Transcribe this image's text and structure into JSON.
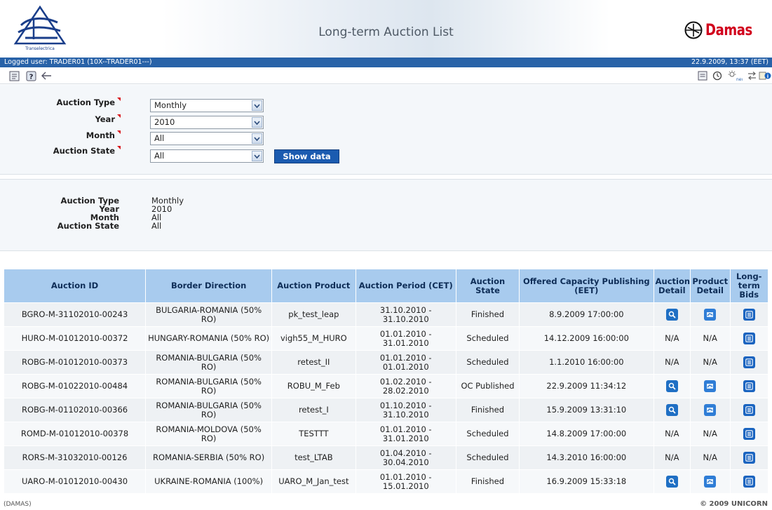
{
  "header": {
    "title": "Long-term Auction List",
    "left_logo_text": "Transelectrica",
    "right_logo_text": "Damas"
  },
  "userbar": {
    "logged_user": "Logged user: TRADER01 (10X--TRADER01---)",
    "datetime": "22.9.2009, 13:37 (EET)"
  },
  "toolbar": {
    "left_icons": [
      "document-icon",
      "help-icon",
      "back-arrow-icon"
    ],
    "right_icons": [
      "list-icon",
      "clock-icon",
      "new-sun-icon",
      "transfer-icon",
      "notes-info-icon"
    ]
  },
  "filter": {
    "auction_type_label": "Auction Type",
    "auction_type_value": "Monthly",
    "year_label": "Year",
    "year_value": "2010",
    "month_label": "Month",
    "month_value": "All",
    "state_label": "Auction State",
    "state_value": "All",
    "show_button": "Show data"
  },
  "summary": {
    "labels": [
      "Auction Type",
      "Year",
      "Month",
      "Auction State"
    ],
    "values": [
      "Monthly",
      "2010",
      "All",
      "All"
    ]
  },
  "table": {
    "headers": [
      "Auction ID",
      "Border Direction",
      "Auction Product",
      "Auction Period (CET)",
      "Auction State",
      "Offered Capacity Publishing (EET)",
      "Auction Detail",
      "Product Detail",
      "Long-term Bids"
    ],
    "rows": [
      {
        "id": "BGRO-M-31102010-00243",
        "border": "BULGARIA-ROMANIA (50% RO)",
        "product": "pk_test_leap",
        "period": "31.10.2010 - 31.10.2010",
        "state": "Finished",
        "publishing": "8.9.2009 17:00:00",
        "auction_detail": "icon",
        "product_detail": "icon"
      },
      {
        "id": "HURO-M-01012010-00372",
        "border": "HUNGARY-ROMANIA (50% RO)",
        "product": "vigh55_M_HURO",
        "period": "01.01.2010 - 31.01.2010",
        "state": "Scheduled",
        "publishing": "14.12.2009 16:00:00",
        "auction_detail": "N/A",
        "product_detail": "N/A"
      },
      {
        "id": "ROBG-M-01012010-00373",
        "border": "ROMANIA-BULGARIA (50% RO)",
        "product": "retest_II",
        "period": "01.01.2010 - 01.01.2010",
        "state": "Scheduled",
        "publishing": "1.1.2010 16:00:00",
        "auction_detail": "N/A",
        "product_detail": "N/A"
      },
      {
        "id": "ROBG-M-01022010-00484",
        "border": "ROMANIA-BULGARIA (50% RO)",
        "product": "ROBU_M_Feb",
        "period": "01.02.2010 - 28.02.2010",
        "state": "OC Published",
        "publishing": "22.9.2009 11:34:12",
        "auction_detail": "icon",
        "product_detail": "icon"
      },
      {
        "id": "ROBG-M-01102010-00366",
        "border": "ROMANIA-BULGARIA (50% RO)",
        "product": "retest_I",
        "period": "01.10.2010 - 31.10.2010",
        "state": "Finished",
        "publishing": "15.9.2009 13:31:10",
        "auction_detail": "icon",
        "product_detail": "icon"
      },
      {
        "id": "ROMD-M-01012010-00378",
        "border": "ROMANIA-MOLDOVA (50% RO)",
        "product": "TESTTT",
        "period": "01.01.2010 - 31.01.2010",
        "state": "Scheduled",
        "publishing": "14.8.2009 17:00:00",
        "auction_detail": "N/A",
        "product_detail": "N/A"
      },
      {
        "id": "RORS-M-31032010-00126",
        "border": "ROMANIA-SERBIA (50% RO)",
        "product": "test_LTAB",
        "period": "01.04.2010 - 30.04.2010",
        "state": "Scheduled",
        "publishing": "14.3.2010 16:00:00",
        "auction_detail": "N/A",
        "product_detail": "N/A"
      },
      {
        "id": "UARO-M-01012010-00430",
        "border": "UKRAINE-ROMANIA (100%)",
        "product": "UARO_M_Jan_test",
        "period": "01.01.2010 - 15.01.2010",
        "state": "Finished",
        "publishing": "16.9.2009 15:33:18",
        "auction_detail": "icon",
        "product_detail": "icon"
      }
    ]
  },
  "footer": {
    "left": "(DAMAS)",
    "right": "© 2009 UNICORN"
  },
  "colors": {
    "brand_blue": "#2862a8",
    "header_cell": "#a8cbee",
    "button": "#1b5bb0",
    "damas_red": "#d1001c"
  }
}
